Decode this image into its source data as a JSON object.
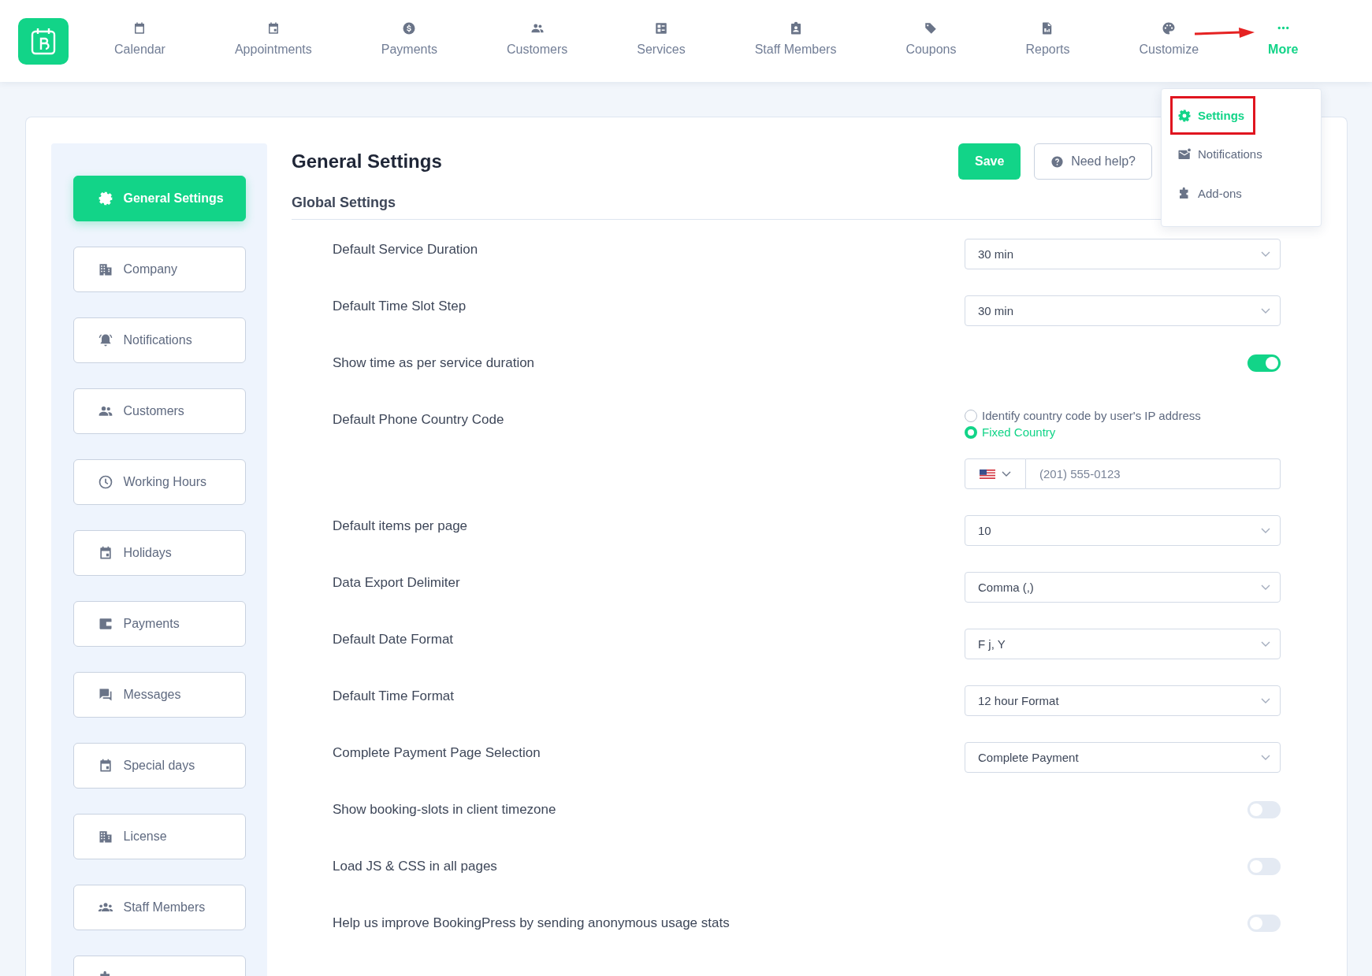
{
  "nav": {
    "items": [
      {
        "label": "Calendar",
        "selected": false
      },
      {
        "label": "Appointments",
        "selected": false
      },
      {
        "label": "Payments",
        "selected": false
      },
      {
        "label": "Customers",
        "selected": false
      },
      {
        "label": "Services",
        "selected": false
      },
      {
        "label": "Staff Members",
        "selected": false
      },
      {
        "label": "Coupons",
        "selected": false
      },
      {
        "label": "Reports",
        "selected": false
      },
      {
        "label": "Customize",
        "selected": false
      },
      {
        "label": "More",
        "selected": true,
        "pointer_arrow": true
      }
    ]
  },
  "more_menu": {
    "items": [
      {
        "label": "Settings",
        "selected": true,
        "highlighted": true
      },
      {
        "label": "Notifications",
        "selected": false,
        "highlighted": false
      },
      {
        "label": "Add-ons",
        "selected": false,
        "highlighted": false
      }
    ]
  },
  "sidebar": {
    "items": [
      {
        "label": "General Settings",
        "selected": true
      },
      {
        "label": "Company",
        "selected": false
      },
      {
        "label": "Notifications",
        "selected": false
      },
      {
        "label": "Customers",
        "selected": false
      },
      {
        "label": "Working Hours",
        "selected": false
      },
      {
        "label": "Holidays",
        "selected": false
      },
      {
        "label": "Payments",
        "selected": false
      },
      {
        "label": "Messages",
        "selected": false
      },
      {
        "label": "Special days",
        "selected": false
      },
      {
        "label": "License",
        "selected": false
      },
      {
        "label": "Staff Members",
        "selected": false
      },
      {
        "selected": false
      }
    ]
  },
  "header": {
    "title": "General Settings",
    "buttons": [
      {
        "label": "Save",
        "kind": "primary"
      },
      {
        "label": "Need help?",
        "kind": "help"
      }
    ]
  },
  "section": {
    "title": "Global Settings"
  },
  "settings": [
    {
      "kind": "select",
      "label": "Default Service Duration",
      "value": "30 min"
    },
    {
      "kind": "select",
      "label": "Default Time Slot Step",
      "value": "30 min"
    },
    {
      "kind": "toggle",
      "label": "Show time as per service duration",
      "on": true
    },
    {
      "kind": "radio",
      "label": "Default Phone Country Code",
      "options": [
        {
          "label": "Identify country code by user's IP address",
          "selected": false
        },
        {
          "label": "Fixed Country",
          "selected": true
        }
      ],
      "phone": {
        "placeholder": "(201) 555-0123"
      }
    },
    {
      "kind": "select",
      "label": "Default items per page",
      "value": "10"
    },
    {
      "kind": "select",
      "label": "Data Export Delimiter",
      "value": "Comma (,)"
    },
    {
      "kind": "select",
      "label": "Default Date Format",
      "value": "F j, Y"
    },
    {
      "kind": "select",
      "label": "Default Time Format",
      "value": "12 hour Format"
    },
    {
      "kind": "select",
      "label": "Complete Payment Page Selection",
      "value": "Complete Payment"
    },
    {
      "kind": "toggle",
      "label": "Show booking-slots in client timezone",
      "on": false
    },
    {
      "kind": "toggle",
      "label": "Load JS & CSS in all pages",
      "on": false
    },
    {
      "kind": "toggle",
      "label": "Help us improve BookingPress by sending anonymous usage stats",
      "on": false
    }
  ]
}
